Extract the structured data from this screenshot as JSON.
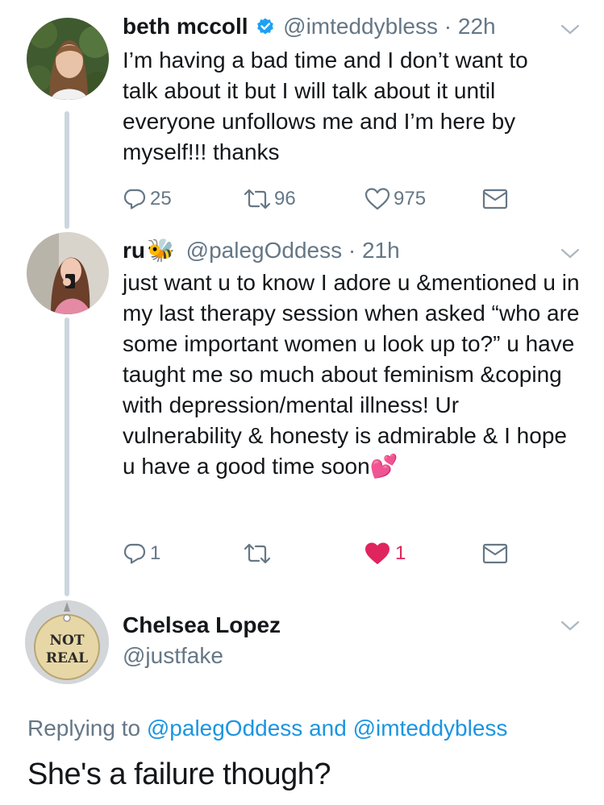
{
  "tweets": [
    {
      "name": "beth mccoll",
      "handle": "@imteddybless",
      "time": "22h",
      "verified": true,
      "text": "I’m having a bad time and I don’t want to talk about it but I will talk about it until everyone unfollows me and I’m here by myself!!! thanks",
      "replies": "25",
      "retweets": "96",
      "likes": "975",
      "liked": false
    },
    {
      "name": "ru",
      "name_emoji": "🐝",
      "handle": "@palegOddess",
      "time": "21h",
      "text": "just want u to know I adore u &mentioned u in my last therapy session when asked “who are some important women u look up to?” u have taught me so much about feminism &coping with depression/mental illness! Ur vulnerability & honesty is admirable & I hope u have a good time soon",
      "text_emoji": "💕",
      "replies": "1",
      "retweets": "",
      "likes": "1",
      "liked": true
    }
  ],
  "reply": {
    "name": "Chelsea Lopez",
    "handle": "@justfake",
    "avatar_text_line1": "NOT",
    "avatar_text_line2": "REAL",
    "replying_prefix": "Replying to",
    "replying_user1": "@palegOddess",
    "replying_and": "and",
    "replying_user2": "@imteddybless",
    "text": "She's a failure though?"
  },
  "icons": [
    "reply-icon",
    "retweet-icon",
    "like-icon",
    "message-icon",
    "verified-icon",
    "chevron-down-icon"
  ],
  "colors": {
    "accent": "#1da1f2",
    "link": "#1b95e0",
    "muted": "#657786",
    "like": "#e0245e",
    "line": "#ccd6dd"
  }
}
